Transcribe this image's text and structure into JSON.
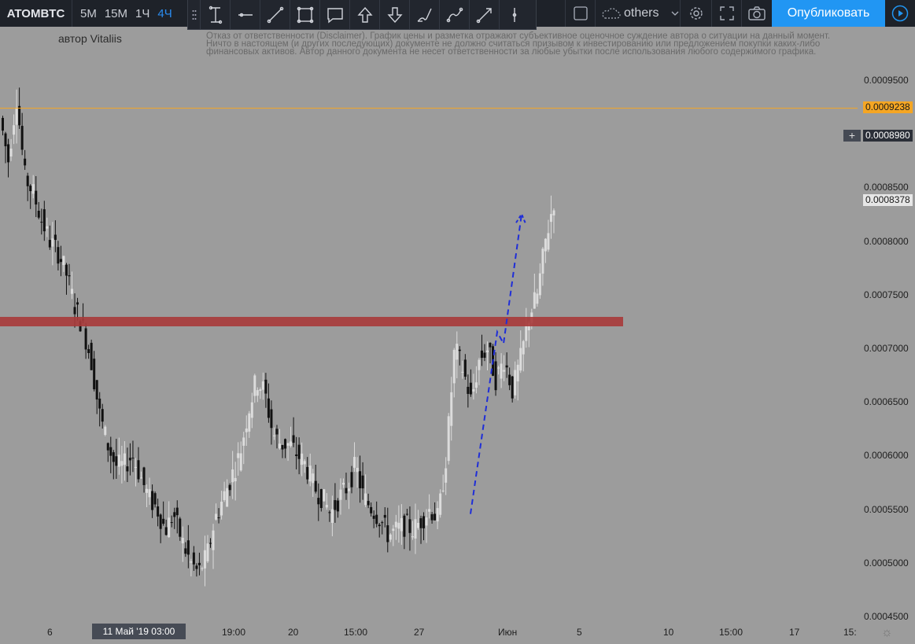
{
  "toolbar": {
    "symbol": "ATOMBTC",
    "timeframes": [
      "5M",
      "15M",
      "1Ч",
      "4Ч"
    ],
    "active_timeframe": "4Ч",
    "drawing_tools": [
      "text-cursor-icon",
      "horizontal-ray-icon",
      "trend-line-icon",
      "rectangle-icon",
      "callout-icon",
      "arrow-up-icon",
      "arrow-down-icon",
      "brush-icon",
      "path-icon",
      "arrow-line-icon",
      "vertical-line-icon"
    ],
    "others_label": "others",
    "publish_label": "Опубликовать"
  },
  "author": "автор Vitaliis",
  "disclaimer": "Отказ от ответственности (Disclaimer). График цены и разметка отражают субъективное оценочное суждение автора о ситуации на данный момент. Ничто в настоящем (и других последующих) документе не должно считаться призывом к инвестированию или предложением покупки каких-либо финансовых активов. Автор данного документа не несет ответственности за любые убытки после использования любого содержимого графика.",
  "price_scale": [
    "0.0009500",
    "0.0008500",
    "0.0008000",
    "0.0007500",
    "0.0007000",
    "0.0006500",
    "0.0006000",
    "0.0005500",
    "0.0005000",
    "0.0004500"
  ],
  "price_tags": {
    "horizontal_line": "0.0009238",
    "crosshair": "0.0008980",
    "last_price": "0.0008378"
  },
  "time_scale": [
    "6",
    "19:00",
    "20",
    "15:00",
    "27",
    "Июн",
    "5",
    "10",
    "15:00",
    "17",
    "15:"
  ],
  "time_tag": "11 Май '19   03:00",
  "colors": {
    "accent": "#2196f3",
    "horizontal_line": "#f5a623",
    "zone": "#a83a3a",
    "projection": "#1f2ed8"
  },
  "chart_data": {
    "type": "candlestick",
    "interval": "4Ч",
    "ylim": [
      0.00045,
      0.00098
    ],
    "date_range": [
      "early May 2019",
      "early June 2019"
    ],
    "horizontal_line": 0.0009238,
    "resistance_zone": [
      0.000721,
      0.000729
    ],
    "last_price": 0.0008378,
    "projection_path": [
      0.000545,
      0.000715,
      0.000704,
      0.000825
    ],
    "close_path": [
      0.000915,
      0.000875,
      0.000935,
      0.00086,
      0.000845,
      0.00082,
      0.0008,
      0.00079,
      0.00077,
      0.00074,
      0.00072,
      0.00069,
      0.00064,
      0.00061,
      0.00059,
      0.00059,
      0.0006,
      0.00058,
      0.00056,
      0.00055,
      0.00053,
      0.000545,
      0.00052,
      0.0005,
      0.00049,
      0.000505,
      0.00054,
      0.00056,
      0.00058,
      0.0006,
      0.00064,
      0.00067,
      0.00066,
      0.00062,
      0.00061,
      0.00061,
      0.0006,
      0.00059,
      0.00057,
      0.00056,
      0.000545,
      0.00056,
      0.00057,
      0.00059,
      0.00056,
      0.00055,
      0.00054,
      0.000525,
      0.00053,
      0.000535,
      0.00053,
      0.00054,
      0.00055,
      0.00054,
      0.0006,
      0.0007,
      0.00068,
      0.00065,
      0.00069,
      0.0007,
      0.00067,
      0.00069,
      0.00066,
      0.00069,
      0.00073,
      0.00075,
      0.0008,
      0.000838
    ]
  }
}
